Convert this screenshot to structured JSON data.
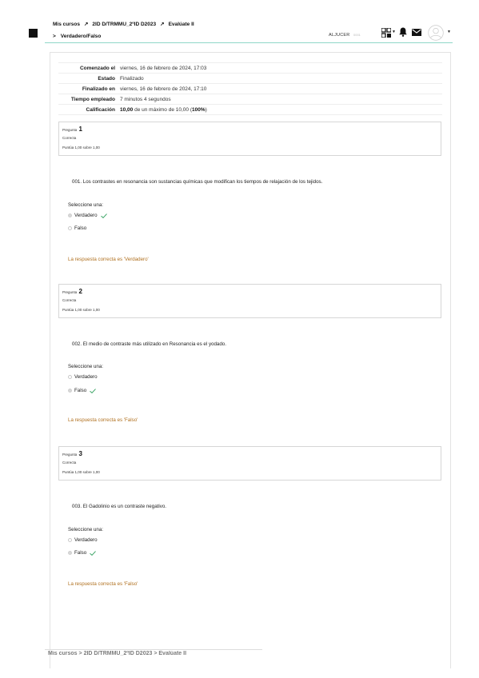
{
  "header": {
    "breadcrumb": [
      "Mis cursos",
      "2ID D/TRMMU_2ºID D2023",
      "Evalúate II"
    ],
    "separator": "↗",
    "sub_chevron": ">",
    "sub_title": "Verdadero/Falso",
    "user_name": "ALJUCER",
    "user_sub": "0001",
    "icons": [
      "menu-icon",
      "grid-apps-icon",
      "bell-icon",
      "mail-icon",
      "avatar-icon",
      "chevron-down-icon"
    ]
  },
  "summary": [
    {
      "label": "Comenzado el",
      "value": "viernes, 16 de febrero de 2024, 17:03"
    },
    {
      "label": "Estado",
      "value": "Finalizado"
    },
    {
      "label": "Finalizado en",
      "value": "viernes, 16 de febrero de 2024, 17:10"
    },
    {
      "label": "Tiempo empleado",
      "value": "7 minutos 4 segundos"
    },
    {
      "label": "Calificación",
      "score": "10,00",
      "mid": " de un máximo de 10,00 (",
      "pct": "100%",
      "end": ")"
    }
  ],
  "questions": [
    {
      "label": "Pregunta",
      "number": "1",
      "state": "Correcta",
      "grade": "Puntúa 1,00 sobre 1,00",
      "text": "001. Los contrastes en resonancia son sustancias químicas que modifican los tiempos de relajación de los tejidos.",
      "prompt": "Seleccione una:",
      "options": [
        {
          "label": "Verdadero",
          "selected": true,
          "correct": true
        },
        {
          "label": "Falso",
          "selected": false,
          "correct": false
        }
      ],
      "answer": "La respuesta correcta es 'Verdadero'"
    },
    {
      "label": "Pregunta",
      "number": "2",
      "state": "Correcta",
      "grade": "Puntúa 1,00 sobre 1,00",
      "text": "002. El medio de contraste más utilizado en Resonancia es el yodado.",
      "prompt": "Seleccione una:",
      "options": [
        {
          "label": "Verdadero",
          "selected": false,
          "correct": false
        },
        {
          "label": "Falso",
          "selected": true,
          "correct": true
        }
      ],
      "answer": "La respuesta correcta es 'Falso'"
    },
    {
      "label": "Pregunta",
      "number": "3",
      "state": "Correcta",
      "grade": "Puntúa 1,00 sobre 1,00",
      "text": "003. El Gadolinio es un contraste negativo.",
      "prompt": "Seleccione una:",
      "options": [
        {
          "label": "Verdadero",
          "selected": false,
          "correct": false
        },
        {
          "label": "Falso",
          "selected": true,
          "correct": true
        }
      ],
      "answer": "La respuesta correcta es 'Falso'"
    }
  ],
  "colors": {
    "accent_line": "#8fd7c8",
    "check": "#2e9e5b",
    "answer": "#b0701f"
  }
}
